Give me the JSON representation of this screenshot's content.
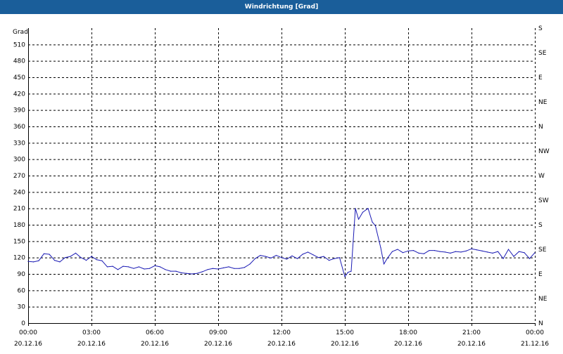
{
  "window": {
    "title": "Windrichtung [Grad]"
  },
  "chart_data": {
    "type": "line",
    "title": "Windrichtung [Grad]",
    "ylabel": "Grad",
    "ylim": [
      0,
      540
    ],
    "y_ticks": [
      0,
      30,
      60,
      90,
      120,
      150,
      180,
      210,
      240,
      270,
      300,
      330,
      360,
      390,
      420,
      450,
      480,
      510
    ],
    "y_right_ticks": [
      {
        "value": 0,
        "label": "N"
      },
      {
        "value": 45,
        "label": "NE"
      },
      {
        "value": 90,
        "label": "E"
      },
      {
        "value": 135,
        "label": "SE"
      },
      {
        "value": 180,
        "label": "S"
      },
      {
        "value": 225,
        "label": "SW"
      },
      {
        "value": 270,
        "label": "W"
      },
      {
        "value": 315,
        "label": "NW"
      },
      {
        "value": 360,
        "label": "N"
      },
      {
        "value": 405,
        "label": "NE"
      },
      {
        "value": 450,
        "label": "E"
      },
      {
        "value": 495,
        "label": "SE"
      },
      {
        "value": 540,
        "label": "S"
      }
    ],
    "xlim": [
      0,
      24
    ],
    "x_ticks": [
      {
        "hour": 0,
        "time": "00:00",
        "date": "20.12.16"
      },
      {
        "hour": 3,
        "time": "03:00",
        "date": "20.12.16"
      },
      {
        "hour": 6,
        "time": "06:00",
        "date": "20.12.16"
      },
      {
        "hour": 9,
        "time": "09:00",
        "date": "20.12.16"
      },
      {
        "hour": 12,
        "time": "12:00",
        "date": "20.12.16"
      },
      {
        "hour": 15,
        "time": "15:00",
        "date": "20.12.16"
      },
      {
        "hour": 18,
        "time": "18:00",
        "date": "20.12.16"
      },
      {
        "hour": 21,
        "time": "21:00",
        "date": "20.12.16"
      },
      {
        "hour": 24,
        "time": "00:00",
        "date": "21.12.16"
      }
    ],
    "grid": true,
    "series": [
      {
        "color": "#1a1ab4",
        "points": [
          [
            0.0,
            113
          ],
          [
            0.25,
            112
          ],
          [
            0.5,
            114
          ],
          [
            0.75,
            127
          ],
          [
            1.0,
            126
          ],
          [
            1.25,
            115
          ],
          [
            1.5,
            112
          ],
          [
            1.75,
            120
          ],
          [
            2.0,
            122
          ],
          [
            2.25,
            128
          ],
          [
            2.5,
            120
          ],
          [
            2.75,
            115
          ],
          [
            3.0,
            122
          ],
          [
            3.25,
            116
          ],
          [
            3.5,
            114
          ],
          [
            3.75,
            103
          ],
          [
            4.0,
            104
          ],
          [
            4.25,
            98
          ],
          [
            4.5,
            104
          ],
          [
            4.75,
            103
          ],
          [
            5.0,
            100
          ],
          [
            5.25,
            103
          ],
          [
            5.5,
            99
          ],
          [
            5.75,
            100
          ],
          [
            6.0,
            105
          ],
          [
            6.25,
            103
          ],
          [
            6.5,
            98
          ],
          [
            6.75,
            95
          ],
          [
            7.0,
            95
          ],
          [
            7.25,
            92
          ],
          [
            7.5,
            91
          ],
          [
            7.75,
            90
          ],
          [
            8.0,
            91
          ],
          [
            8.25,
            94
          ],
          [
            8.5,
            98
          ],
          [
            8.75,
            100
          ],
          [
            9.0,
            99
          ],
          [
            9.25,
            101
          ],
          [
            9.5,
            103
          ],
          [
            9.75,
            100
          ],
          [
            10.0,
            100
          ],
          [
            10.25,
            102
          ],
          [
            10.5,
            108
          ],
          [
            10.75,
            118
          ],
          [
            11.0,
            124
          ],
          [
            11.25,
            122
          ],
          [
            11.5,
            119
          ],
          [
            11.75,
            124
          ],
          [
            12.0,
            120
          ],
          [
            12.25,
            117
          ],
          [
            12.5,
            123
          ],
          [
            12.75,
            118
          ],
          [
            13.0,
            126
          ],
          [
            13.25,
            130
          ],
          [
            13.5,
            125
          ],
          [
            13.75,
            120
          ],
          [
            14.0,
            122
          ],
          [
            14.25,
            115
          ],
          [
            14.5,
            118
          ],
          [
            14.75,
            120
          ],
          [
            15.0,
            85
          ],
          [
            15.15,
            93
          ],
          [
            15.3,
            95
          ],
          [
            15.5,
            210
          ],
          [
            15.65,
            190
          ],
          [
            15.85,
            203
          ],
          [
            16.1,
            210
          ],
          [
            16.3,
            185
          ],
          [
            16.45,
            178
          ],
          [
            16.7,
            138
          ],
          [
            16.85,
            108
          ],
          [
            17.0,
            118
          ],
          [
            17.25,
            131
          ],
          [
            17.5,
            135
          ],
          [
            17.75,
            129
          ],
          [
            18.0,
            132
          ],
          [
            18.25,
            133
          ],
          [
            18.5,
            128
          ],
          [
            18.75,
            127
          ],
          [
            19.0,
            133
          ],
          [
            19.25,
            133
          ],
          [
            19.5,
            131
          ],
          [
            19.75,
            130
          ],
          [
            20.0,
            128
          ],
          [
            20.25,
            131
          ],
          [
            20.5,
            130
          ],
          [
            20.75,
            132
          ],
          [
            21.0,
            136
          ],
          [
            21.25,
            134
          ],
          [
            21.5,
            132
          ],
          [
            21.75,
            130
          ],
          [
            22.0,
            128
          ],
          [
            22.25,
            131
          ],
          [
            22.5,
            118
          ],
          [
            22.75,
            135
          ],
          [
            23.0,
            122
          ],
          [
            23.25,
            131
          ],
          [
            23.5,
            129
          ],
          [
            23.75,
            118
          ],
          [
            24.0,
            129
          ]
        ]
      }
    ]
  }
}
